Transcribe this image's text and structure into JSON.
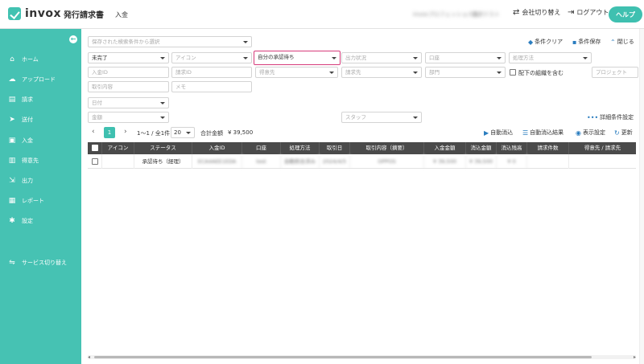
{
  "header": {
    "logo_text": "invox",
    "logo_sub": "発行請求書",
    "page_title": "入金",
    "company_blur": "invoxプロフェッショナル",
    "user_blur": "請求テスト",
    "switch_company": "会社切り替え",
    "logout": "ログアウト",
    "help": "ヘルプ"
  },
  "sidebar": {
    "items": [
      {
        "label": "ホーム",
        "icon": "home-icon"
      },
      {
        "label": "アップロード",
        "icon": "cloud-upload-icon"
      },
      {
        "label": "請求",
        "icon": "document-icon"
      },
      {
        "label": "送付",
        "icon": "send-icon"
      },
      {
        "label": "入金",
        "icon": "inbox-icon"
      },
      {
        "label": "得意先",
        "icon": "building-icon"
      },
      {
        "label": "出力",
        "icon": "export-icon"
      },
      {
        "label": "レポート",
        "icon": "chart-icon"
      },
      {
        "label": "設定",
        "icon": "gear-icon"
      },
      {
        "label": "サービス切り替え",
        "icon": "switch-icon"
      }
    ]
  },
  "filters": {
    "saved_search_placeholder": "保存された検索条件から選択",
    "clear": "条件クリア",
    "save": "条件保存",
    "close": "閉じる",
    "status": "未完了",
    "icon": "アイコン",
    "approval": "自分の承認待ち",
    "output_status": "出力状況",
    "account": "口座",
    "process_method": "処理方法",
    "payment_id": "入金ID",
    "invoice_id": "請求ID",
    "customer": "得意先",
    "billing_to": "請求先",
    "department": "部門",
    "include_sub_org": "配下の組織を含む",
    "project": "プロジェクト",
    "transaction_content": "取引内容",
    "memo": "メモ",
    "date": "日付",
    "amount": "金額",
    "staff": "スタッフ",
    "advanced": "詳細条件設定"
  },
  "pager": {
    "page": "1",
    "range": "1〜1 / 全1件",
    "per_page": "20",
    "total_label": "合計金額",
    "total_value": "¥ 39,500"
  },
  "actions": {
    "auto_reconcile": "自動消込",
    "auto_reconcile_result": "自動消込結果",
    "display_settings": "表示設定",
    "refresh": "更新"
  },
  "table": {
    "headers": [
      "アイコン",
      "ステータス",
      "入金ID",
      "口座",
      "処理方法",
      "取引日",
      "取引内容（摘要）",
      "入金金額",
      "消込金額",
      "消込残高",
      "請求件数",
      "得意先 / 請求先"
    ],
    "rows": [
      {
        "status": "承認待ち（経理）",
        "payment_id": "ECA4AEE1EDA",
        "account": "test",
        "method": "自動照合済み",
        "date": "2024/4/5",
        "content": "OPPOS",
        "amount": "¥ 39,500",
        "reconciled": "¥ 39,500",
        "balance": "¥ 0"
      }
    ]
  },
  "colors": {
    "brand": "#46c2b3",
    "highlight": "#d63a7a",
    "header_bg": "#4a4a4a"
  }
}
